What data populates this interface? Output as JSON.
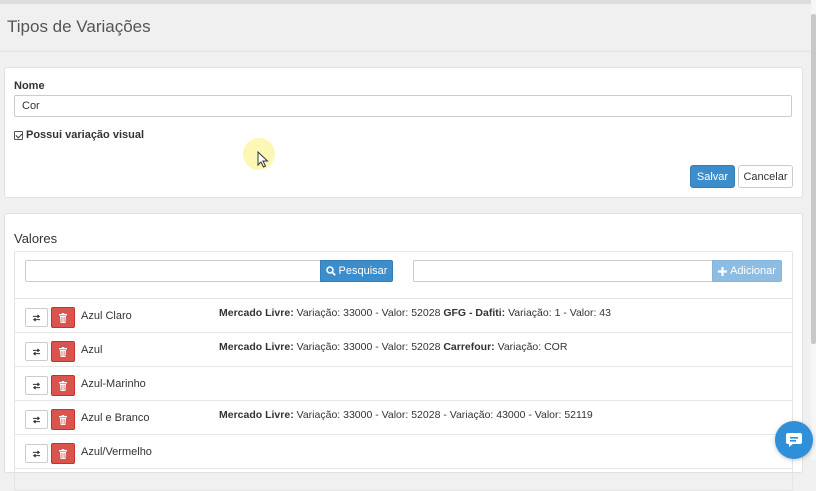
{
  "page": {
    "title": "Tipos de Variações"
  },
  "form": {
    "name_label": "Nome",
    "name_value": "Cor",
    "visual_label": "Possui variação visual",
    "visual_checked": true,
    "save_label": "Salvar",
    "cancel_label": "Cancelar"
  },
  "values_panel": {
    "title": "Valores",
    "search_value": "",
    "search_button": "Pesquisar",
    "add_value": "",
    "add_button": "Adicionar",
    "rows": [
      {
        "name": "Azul Claro",
        "detail": [
          {
            "b": "Mercado Livre:",
            "t": " Variação: 33000 - Valor: 52028 "
          },
          {
            "b": "GFG - Dafiti:",
            "t": " Variação: 1 - Valor: 43"
          }
        ]
      },
      {
        "name": "Azul",
        "detail": [
          {
            "b": "Mercado Livre:",
            "t": " Variação: 33000 - Valor: 52028 "
          },
          {
            "b": "Carrefour:",
            "t": " Variação: COR"
          }
        ]
      },
      {
        "name": "Azul-Marinho",
        "detail": []
      },
      {
        "name": "Azul e Branco",
        "detail": [
          {
            "b": "Mercado Livre:",
            "t": " Variação: 33000 - Valor: 52028 - Variação: 43000 - Valor: 52119"
          }
        ]
      },
      {
        "name": "Azul/Vermelho",
        "detail": []
      }
    ]
  },
  "icons": {
    "swap": "swap-arrows-icon",
    "delete": "trash-icon",
    "search": "search-icon",
    "add": "plus-icon",
    "chat": "chat-icon"
  },
  "colors": {
    "primary": "#3c8dcb",
    "danger": "#d9534f",
    "add_disabled": "#8ebde3",
    "chat": "#2f8fd8"
  }
}
